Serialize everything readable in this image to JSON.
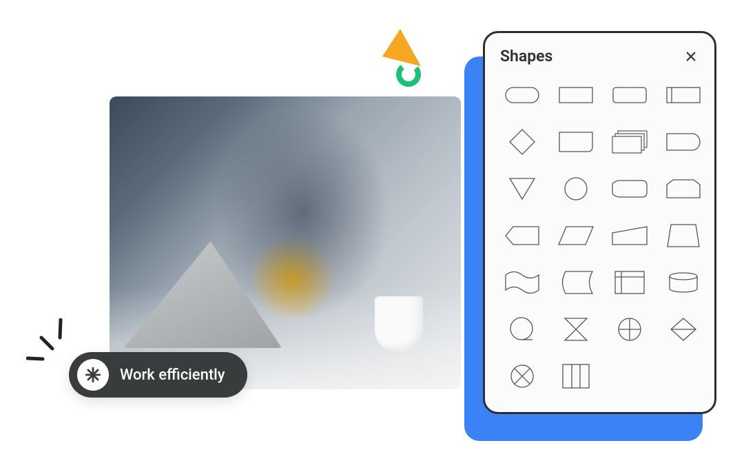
{
  "chip": {
    "label": "Work efficiently",
    "icon": "asterisk-icon"
  },
  "panel": {
    "title": "Shapes",
    "shapes": [
      {
        "id": "terminator"
      },
      {
        "id": "process"
      },
      {
        "id": "rounded-rect"
      },
      {
        "id": "predefined-process"
      },
      {
        "id": "decision"
      },
      {
        "id": "card"
      },
      {
        "id": "multi-document"
      },
      {
        "id": "direct-data"
      },
      {
        "id": "extract"
      },
      {
        "id": "connector"
      },
      {
        "id": "display"
      },
      {
        "id": "off-page"
      },
      {
        "id": "tag-left"
      },
      {
        "id": "data"
      },
      {
        "id": "manual-operation"
      },
      {
        "id": "trapezoid"
      },
      {
        "id": "punched-tape"
      },
      {
        "id": "stored-data"
      },
      {
        "id": "internal-storage"
      },
      {
        "id": "database"
      },
      {
        "id": "sequential-access"
      },
      {
        "id": "collate"
      },
      {
        "id": "or-gate"
      },
      {
        "id": "sort"
      },
      {
        "id": "summing-junction"
      },
      {
        "id": "internal-columns"
      }
    ]
  },
  "colors": {
    "accent": "#3b82f6",
    "chip_bg": "#393c3d",
    "arrow": "#f5a623",
    "ring": "#1fbf7a"
  }
}
